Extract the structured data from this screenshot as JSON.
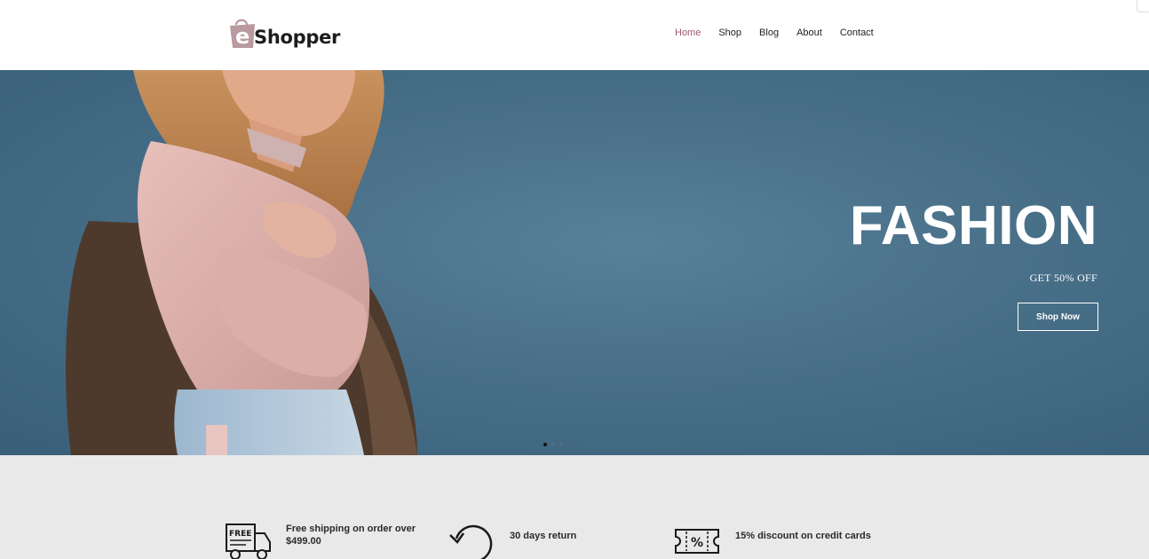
{
  "brand": {
    "logo_text": "Shopper",
    "logo_letter": "e",
    "accent_color": "#9c5b6b"
  },
  "nav": {
    "items": [
      {
        "label": "Home",
        "active": true
      },
      {
        "label": "Shop",
        "active": false
      },
      {
        "label": "Blog",
        "active": false
      },
      {
        "label": "About",
        "active": false
      },
      {
        "label": "Contact",
        "active": false
      }
    ]
  },
  "hero": {
    "title": "FASHION",
    "subtitle": "GET 50% OFF",
    "button_label": "Shop Now",
    "slide_count": 3,
    "active_slide": 1,
    "background_color": "#4a7189"
  },
  "features": [
    {
      "icon": "free-delivery-truck-icon",
      "text_line1": "Free shipping on order over",
      "text_line2": "$499.00"
    },
    {
      "icon": "return-arrow-icon",
      "text_line1": "30 days return",
      "text_line2": ""
    },
    {
      "icon": "discount-coupon-icon",
      "text_line1": "15% discount on credit cards",
      "text_line2": ""
    }
  ],
  "icons": {
    "truck_badge": "FREE",
    "coupon_symbol": "%"
  }
}
